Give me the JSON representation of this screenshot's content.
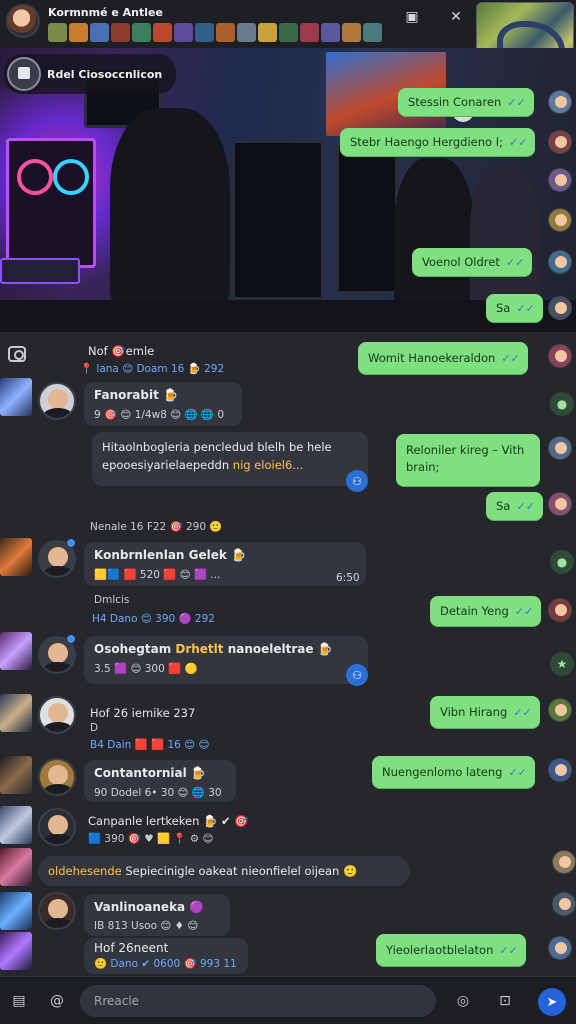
{
  "header": {
    "title": "Kormnmé e Antlee",
    "strip_colors": [
      "#7a8a4a",
      "#c77d2f",
      "#4a6fb3",
      "#8d3d2f",
      "#3b7d5d",
      "#b8482e",
      "#5e4a9a",
      "#2f5f8a",
      "#a8612b",
      "#6a7a8a",
      "#c9a23a",
      "#3a6a4a",
      "#9a3a4a",
      "#5a5a9a",
      "#b07a3a",
      "#4a7a7a"
    ],
    "actions": {
      "pip_icon": "picture-in-picture-icon",
      "close_icon": "close-icon"
    }
  },
  "hero": {
    "label": "Rdel Ciosoccnlicon"
  },
  "messages": {
    "out": [
      {
        "text": "Stessin Conaren",
        "tick": "✓✓"
      },
      {
        "text": "Stebr Haengo Hergdieno I;",
        "tick": "✓✓"
      },
      {
        "text": "Voenol Oldret",
        "tick": "✓✓"
      },
      {
        "text": "Sa",
        "tick": "✓✓"
      },
      {
        "text": "Womit Hanoekeraldon",
        "tick": "✓✓"
      },
      {
        "text": "Reloniler kireg – Vith brain;",
        "tick": "✓✓"
      },
      {
        "text": "Sa",
        "tick": "✓✓"
      },
      {
        "text": "Detain Yeng",
        "tick": "✓✓"
      },
      {
        "text": "Vibn Hirang",
        "tick": "✓✓"
      },
      {
        "text": "Nuengenlomo lateng",
        "tick": "✓✓"
      },
      {
        "text": "Yieolerlaotblelaton",
        "tick": "✓✓"
      }
    ],
    "in": [
      {
        "name": "Nof 🎯emle",
        "meta": "📍 lana 😊 Doam  16 🍺 292"
      },
      {
        "name": "Fanorabit 🍺",
        "meta": "9 🎯 😊 1/4w8 😊 🌐 🌐 0"
      },
      {
        "body_a": "Hitaolnbogleria pencledud blelh be hele",
        "body_b": "epooesiyarielaepeddn ",
        "body_hi": "nig eloiel6..."
      },
      {
        "meta": "Nenale 16 F22 🎯 290 🙂"
      },
      {
        "name": "Konbrnlenlan Gelek 🍺",
        "meta": "🟨🟦 🟥 520 🟥 😊 🟪 ...",
        "time": "6:50"
      },
      {
        "name": "Dmlcis",
        "meta": "H4 Dano 😊 390 🟣  292"
      },
      {
        "name": "Osohegtam ",
        "name_hi": "Drhetlt",
        "name_rest": " nanoeleltrae 🍺",
        "meta": "3.5 🟪 😊 300 🟥 🟡"
      },
      {
        "name": "Hof 26 iemike  237",
        "sub": "D",
        "meta": "B4 Dain 🟥 🟥 16 😊 😊"
      },
      {
        "name": "Contantornial 🍺",
        "meta": "90 Dodel 6• 30 😊 🌐 30"
      },
      {
        "name": "Canpanle lertkeken 🍺 ✔ 🎯",
        "meta": "🟦 390 🎯 ♥ 🟨 📍 ⚙ 😊"
      },
      {
        "body_hi": "oldehesende",
        "body_b": " Sepiecinigle oakeat nieonfielel oijean",
        "meta": "🙂"
      },
      {
        "name": "Vanlinoaneka 🟣",
        "meta": "IB 813 Usoo 😊 ♦ 😊"
      },
      {
        "name": "Hof 26neent",
        "meta": "🙂 Dano ✔ 0600 🎯 993 11"
      }
    ]
  },
  "composer": {
    "placeholder": "Rreacle",
    "icons": [
      "gallery-icon",
      "mention-icon",
      "emoji-icon",
      "gif-icon",
      "send-icon"
    ]
  }
}
